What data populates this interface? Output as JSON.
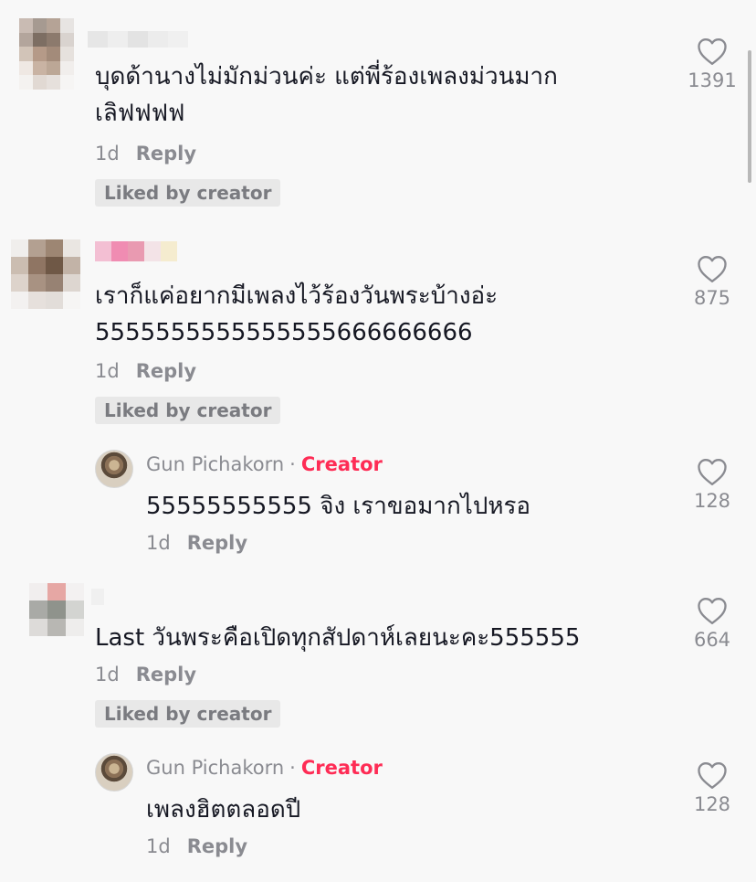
{
  "comments": [
    {
      "text_line1": "บุดด้านางไม่มักม่วนค่ะ แต่พี่ร้องเพลงม่วนมาก",
      "text_line2": "เลิฟฟฟฟ",
      "time": "1d",
      "reply_label": "Reply",
      "liked_label": "Liked by creator",
      "likes": "1391"
    },
    {
      "text_line1": "เราก็แค่อยากมีเพลงไว้ร้องวันพระบ้างอ่ะ",
      "text_line2": "5555555555555555666666666",
      "time": "1d",
      "reply_label": "Reply",
      "liked_label": "Liked by creator",
      "likes": "875",
      "reply": {
        "username": "Gun Pichakorn",
        "separator": "·",
        "badge": "Creator",
        "text": "55555555555 จิง เราขอมากไปหรอ",
        "time": "1d",
        "reply_label": "Reply",
        "likes": "128"
      }
    },
    {
      "text_line1": "Last วันพระคือเปิดทุกสัปดาห์เลยนะคะ555555",
      "time": "1d",
      "reply_label": "Reply",
      "liked_label": "Liked by creator",
      "likes": "664",
      "reply": {
        "username": "Gun Pichakorn",
        "separator": "·",
        "badge": "Creator",
        "text": "เพลงฮิตตลอดปี",
        "time": "1d",
        "reply_label": "Reply",
        "likes": "128"
      }
    }
  ],
  "colors": {
    "background": "#f8f8f8",
    "text": "#161823",
    "secondary": "#8a8b91",
    "creator_badge": "#fe2c55",
    "liked_chip": "#e8e8e8"
  },
  "icons": {
    "like": "heart-outline-icon"
  }
}
